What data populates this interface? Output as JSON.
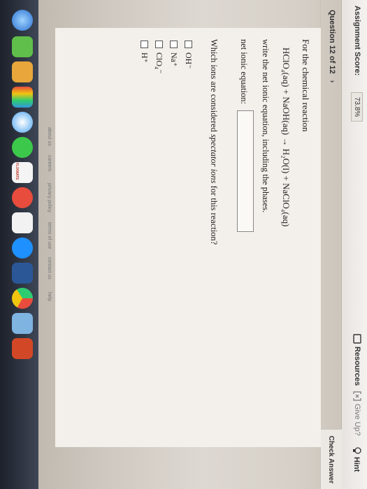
{
  "header": {
    "score_label": "Assignment Score:",
    "score_value": "73.8%",
    "resources_label": "Resources",
    "give_up_label": "Give Up?",
    "hint_label": "Hint",
    "check_label": "Check Answer"
  },
  "question": {
    "number_label": "Question 12 of 12",
    "intro": "For the chemical reaction",
    "equation": "HClO₄(aq) + NaOH(aq) → H₂O(l) + NaClO₄(aq)",
    "instruction": "write the net ionic equation, including the phases.",
    "net_ionic_label": "net ionic equation:",
    "net_ionic_value": "",
    "spectator_prefix": "Which ions are considered ",
    "spectator_em": "spectator ions",
    "spectator_suffix": " for this reaction?",
    "options": [
      "OH⁻",
      "Na⁺",
      "ClO₄⁻",
      "H⁺"
    ]
  },
  "footer": {
    "links": [
      "about us",
      "careers",
      "privacy policy",
      "terms of use",
      "contact us",
      "help"
    ]
  },
  "dock": {
    "badge": "FLIXMATE"
  },
  "colors": {
    "page_bg": "#f3efea",
    "dock_bg": "#1e2533",
    "accent_blue": "#2c6fd6"
  }
}
